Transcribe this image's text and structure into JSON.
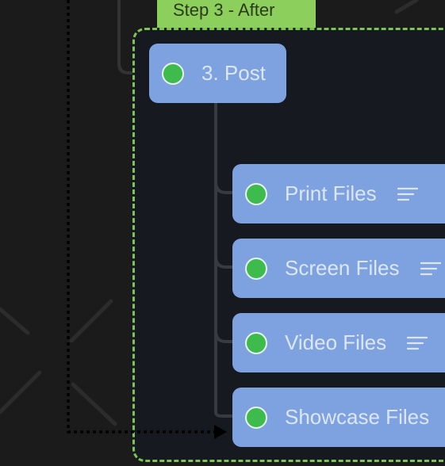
{
  "frame": {
    "label": "Step 3 - After",
    "border_color": "#7bc653",
    "label_bg": "#8ccf5c"
  },
  "root_node": {
    "label": "3. Post",
    "status": "complete",
    "status_color": "#3dbb4d"
  },
  "child_nodes": [
    {
      "label": "Print Files",
      "status": "complete",
      "has_notes": true
    },
    {
      "label": "Screen Files",
      "status": "complete",
      "has_notes": true
    },
    {
      "label": "Video Files",
      "status": "complete",
      "has_notes": true
    },
    {
      "label": "Showcase Files",
      "status": "complete",
      "has_notes": false
    }
  ],
  "colors": {
    "node_bg": "#7ea2e0",
    "node_text": "#dce6f7",
    "canvas_bg": "#1b1b1b",
    "frame_bg": "#16191f"
  },
  "icons": {
    "status": "status-dot-icon",
    "notes": "notes-lines-icon"
  }
}
